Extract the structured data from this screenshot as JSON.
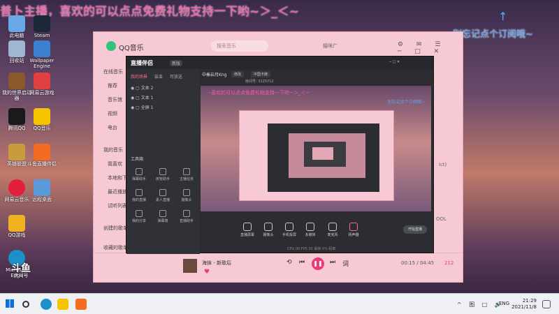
{
  "overlay": {
    "top_text": "普卜主播，喜欢的可以点点免费礼物支持一下哟~＞_＜~",
    "side_text": "别忘记点个订阅哦~",
    "arrow": "↑"
  },
  "desktop_icons": [
    {
      "label": "此电脑",
      "color": "#6aa8e8"
    },
    {
      "label": "Steam",
      "color": "#1b2838"
    },
    {
      "label": "回收站",
      "color": "#9fb7d0"
    },
    {
      "label": "Wallpaper Engine",
      "color": "#3a7fd0"
    },
    {
      "label": "我的世界启动器",
      "color": "#8b5a2b"
    },
    {
      "label": "网易云游戏",
      "color": "#e04040"
    },
    {
      "label": "腾讯QQ",
      "color": "#1a1a1a"
    },
    {
      "label": "QQ音乐",
      "color": "#f5c400"
    },
    {
      "label": "英雄联盟",
      "color": "#c89b3c"
    },
    {
      "label": "斗鱼直播伴侣",
      "color": "#f26d22"
    },
    {
      "label": "网易云音乐",
      "color": "#e0203a"
    },
    {
      "label": "远程桌面",
      "color": "#5a9ad8"
    },
    {
      "label": "QQ游戏",
      "color": "#f0b020"
    },
    {
      "label": "Microsoft Edge",
      "color": "#1e90c8"
    }
  ],
  "qq_music": {
    "title": "QQ音乐",
    "search_placeholder": "搜索音乐",
    "user": "猫咪广",
    "nav": [
      "在线音乐",
      "推荐",
      "音乐馆",
      "视频",
      "电台",
      "我的音乐",
      "我喜欢",
      "本地和下载",
      "最近播放",
      "试听列表",
      "创建的歌单",
      "收藏的歌单"
    ],
    "player": {
      "song": "海抹",
      "artist": "新歌后",
      "time": "00:15 / 04:45",
      "count": "212"
    },
    "right_labels": [
      "ict)",
      "OOL"
    ]
  },
  "live_app": {
    "brand": "直播伴侣",
    "version": "新版",
    "tabs": [
      "我的场景",
      "装束",
      "可放送"
    ],
    "scenes": [
      "文本 2",
      "文本 1",
      "全屏 1"
    ],
    "tools_label": "工具箱",
    "tools": [
      "弹幕助手",
      "房管助手",
      "主播任务",
      "我的直播",
      "素人直播",
      "摄像头",
      "我的分享",
      "弹幕墙",
      "直播助手"
    ],
    "header_name": "中秦启月Kng",
    "header_btn": "修改",
    "category": "中国卡牌",
    "room_line": "房间号: 3125712",
    "buttons": [
      "直播屏幕",
      "摄像头",
      "手机投屏",
      "多媒体",
      "麦克风",
      "扬声器"
    ],
    "start_label": "开始直播",
    "stats": "CPU 00  FPS 30  丢帧 0%  码率"
  },
  "preview": {
    "inner_text": "--喜欢的可以点点免费礼物支持一下哟~＞_＜~",
    "inner_side": "别忘记点个订阅哦~"
  },
  "watermark": {
    "big": "斗鱼",
    "small": "房间号"
  },
  "taskbar": {
    "time": "21:29",
    "date": "2021/11/8",
    "lang": "ENG",
    "tray": "^ 图 □ 🔊"
  }
}
